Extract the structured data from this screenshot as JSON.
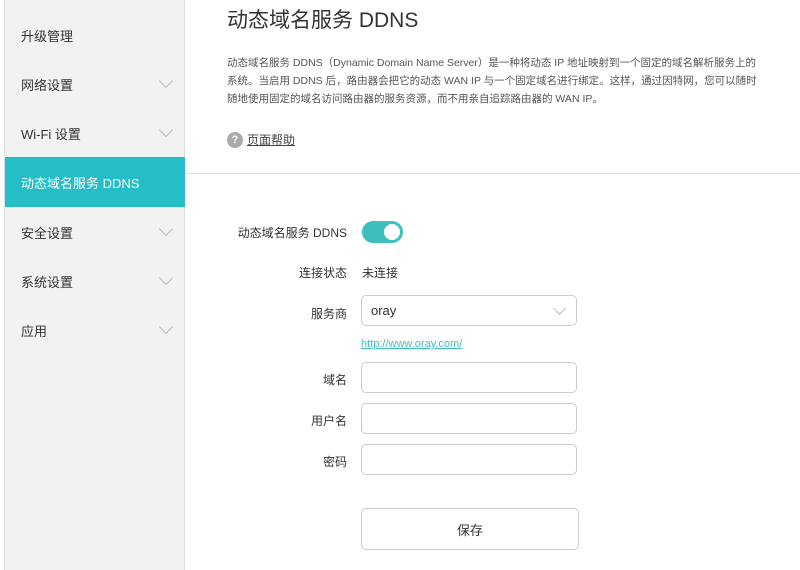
{
  "sidebar": {
    "items": [
      {
        "label": "升级管理"
      },
      {
        "label": "网络设置"
      },
      {
        "label": "Wi-Fi 设置"
      },
      {
        "label": "动态域名服务 DDNS"
      },
      {
        "label": "安全设置"
      },
      {
        "label": "系统设置"
      },
      {
        "label": "应用"
      }
    ]
  },
  "page": {
    "title": "动态域名服务 DDNS",
    "description": "动态域名服务 DDNS（Dynamic Domain Name Server）是一种将动态 IP 地址映射到一个固定的域名解析服务上的系统。当启用 DDNS 后，路由器会把它的动态 WAN IP 与一个固定域名进行绑定。这样，通过因特网，您可以随时随地使用固定的域名访问路由器的服务资源，而不用亲自追踪路由器的 WAN IP。",
    "help_icon": "?",
    "help_label": "页面帮助"
  },
  "form": {
    "ddns_label": "动态域名服务 DDNS",
    "ddns_enabled": true,
    "status_label": "连接状态",
    "status_value": "未连接",
    "provider_label": "服务商",
    "provider_value": "oray",
    "provider_link": "http://www.oray.com/",
    "domain_label": "域名",
    "domain_value": "",
    "username_label": "用户名",
    "username_value": "",
    "password_label": "密码",
    "password_value": "",
    "save_label": "保存"
  },
  "colors": {
    "accent": "#26bec6"
  }
}
